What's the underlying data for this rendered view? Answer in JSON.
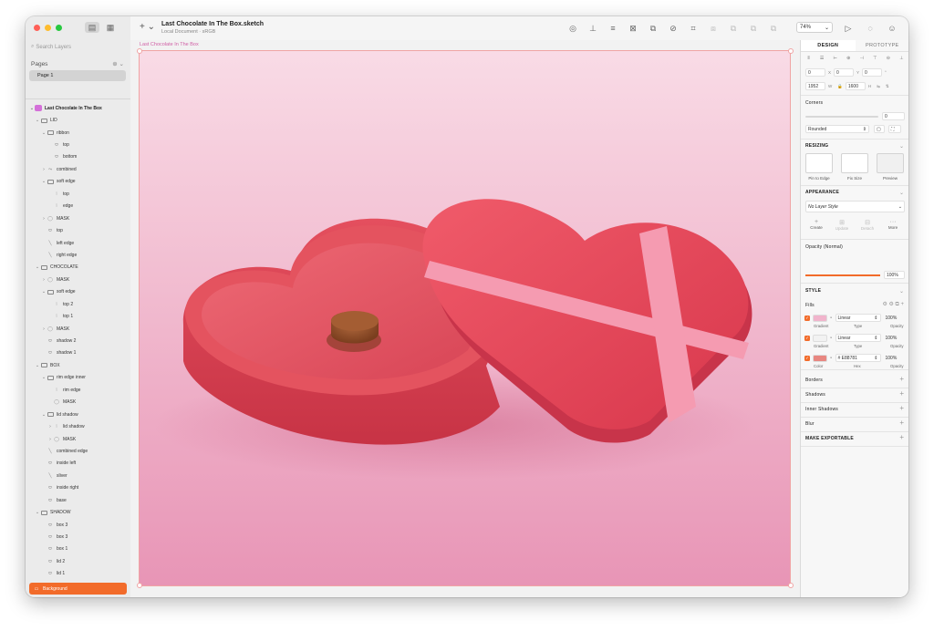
{
  "window": {
    "traffic_colors": [
      "#ff5f57",
      "#febc2e",
      "#28c840"
    ]
  },
  "sidebar": {
    "search_placeholder": "Search Layers",
    "pages_label": "Pages",
    "page_item": "Page 1",
    "document_layer": "Last Chocolate In The Box",
    "layers": [
      {
        "label": "LID",
        "indent": 0,
        "icon": "folder",
        "arrow": "v"
      },
      {
        "label": "ribbon",
        "indent": 1,
        "icon": "folder",
        "arrow": "v"
      },
      {
        "label": "top",
        "indent": 2,
        "icon": "shape",
        "arrow": ""
      },
      {
        "label": "bottom",
        "indent": 2,
        "icon": "shape",
        "arrow": ""
      },
      {
        "label": "combined",
        "indent": 1,
        "icon": "combined",
        "arrow": ">"
      },
      {
        "label": "soft edge",
        "indent": 1,
        "icon": "folder",
        "arrow": "v"
      },
      {
        "label": "top",
        "indent": 2,
        "icon": "path",
        "arrow": ""
      },
      {
        "label": "edge",
        "indent": 2,
        "icon": "path",
        "arrow": ""
      },
      {
        "label": "MASK",
        "indent": 1,
        "icon": "mask",
        "arrow": ">"
      },
      {
        "label": "top",
        "indent": 1,
        "icon": "shape",
        "arrow": ""
      },
      {
        "label": "left edge",
        "indent": 1,
        "icon": "line",
        "arrow": ""
      },
      {
        "label": "right edge",
        "indent": 1,
        "icon": "line",
        "arrow": ""
      },
      {
        "label": "CHOCOLATE",
        "indent": 0,
        "icon": "folder",
        "arrow": "v"
      },
      {
        "label": "MASK",
        "indent": 1,
        "icon": "mask",
        "arrow": ">"
      },
      {
        "label": "soft edge",
        "indent": 1,
        "icon": "folder",
        "arrow": "v"
      },
      {
        "label": "top 2",
        "indent": 2,
        "icon": "path",
        "arrow": ""
      },
      {
        "label": "top 1",
        "indent": 2,
        "icon": "path",
        "arrow": ""
      },
      {
        "label": "MASK",
        "indent": 1,
        "icon": "mask",
        "arrow": ">"
      },
      {
        "label": "shadow 2",
        "indent": 1,
        "icon": "shape",
        "arrow": ""
      },
      {
        "label": "shadow 1",
        "indent": 1,
        "icon": "shape",
        "arrow": ""
      },
      {
        "label": "BOX",
        "indent": 0,
        "icon": "folder",
        "arrow": "v"
      },
      {
        "label": "rim edge inner",
        "indent": 1,
        "icon": "folder",
        "arrow": "v"
      },
      {
        "label": "rim edge",
        "indent": 2,
        "icon": "path",
        "arrow": ""
      },
      {
        "label": "MASK",
        "indent": 2,
        "icon": "mask",
        "arrow": ""
      },
      {
        "label": "lid shadow",
        "indent": 1,
        "icon": "folder",
        "arrow": "v"
      },
      {
        "label": "lid shadow",
        "indent": 2,
        "icon": "path",
        "arrow": ">"
      },
      {
        "label": "MASK",
        "indent": 2,
        "icon": "mask",
        "arrow": ">"
      },
      {
        "label": "combined edge",
        "indent": 1,
        "icon": "line",
        "arrow": ""
      },
      {
        "label": "inside left",
        "indent": 1,
        "icon": "shape",
        "arrow": ""
      },
      {
        "label": "sliver",
        "indent": 1,
        "icon": "line",
        "arrow": ""
      },
      {
        "label": "inside right",
        "indent": 1,
        "icon": "shape",
        "arrow": ""
      },
      {
        "label": "base",
        "indent": 1,
        "icon": "shape",
        "arrow": ""
      },
      {
        "label": "SHADOW",
        "indent": 0,
        "icon": "folder",
        "arrow": "v"
      },
      {
        "label": "box 3",
        "indent": 1,
        "icon": "shape",
        "arrow": ""
      },
      {
        "label": "box 3",
        "indent": 1,
        "icon": "shape",
        "arrow": ""
      },
      {
        "label": "box 1",
        "indent": 1,
        "icon": "shape",
        "arrow": ""
      },
      {
        "label": "lid 2",
        "indent": 1,
        "icon": "shape",
        "arrow": ""
      },
      {
        "label": "lid 1",
        "indent": 1,
        "icon": "shape",
        "arrow": ""
      }
    ],
    "selected_layer": "Background",
    "selected_color": "#f26b2a"
  },
  "toolbar": {
    "title": "Last Chocolate In The Box.sketch",
    "subtitle": "Local Document · sRGB",
    "zoom": "74%"
  },
  "canvas": {
    "artboard_label": "Last Chocolate In The Box"
  },
  "inspector": {
    "tab_design": "DESIGN",
    "tab_prototype": "PROTOTYPE",
    "x": "0",
    "x_label": "X",
    "y": "0",
    "y_label": "Y",
    "rotation": "0",
    "rotation_label": "°",
    "width": "1952",
    "width_label": "W",
    "height": "1600",
    "height_label": "H",
    "corners_label": "Corners",
    "corners_value": "0",
    "corner_style": "Rounded",
    "resizing_label": "RESIZING",
    "pin_label": "Pin to Edge",
    "fix_label": "Fix Size",
    "preview_label": "Preview",
    "appearance_label": "APPEARANCE",
    "layer_style": "No Layer Style",
    "create": "Create",
    "update": "Update",
    "detach": "Detach",
    "more": "More",
    "opacity_label": "Opacity (Normal)",
    "opacity_value": "100%",
    "opacity_fraction": 1.0,
    "style_label": "STYLE",
    "fills_label": "Fills",
    "fills": [
      {
        "swatch": "#f1b4cc",
        "kind": "Linear",
        "opacity": "100%",
        "sub1": "Gradient",
        "sub2": "Type",
        "sub3": "Opacity"
      },
      {
        "swatch": "#f2f2f2",
        "kind": "Linear",
        "opacity": "100%",
        "sub1": "Gradient",
        "sub2": "Type",
        "sub3": "Opacity"
      },
      {
        "swatch": "#e88781",
        "kind": "# E88781",
        "opacity": "100%",
        "sub1": "Color",
        "sub2": "Hex",
        "sub3": "Opacity"
      }
    ],
    "borders_label": "Borders",
    "shadows_label": "Shadows",
    "inner_shadows_label": "Inner Shadows",
    "blur_label": "Blur",
    "export_label": "MAKE EXPORTABLE"
  }
}
